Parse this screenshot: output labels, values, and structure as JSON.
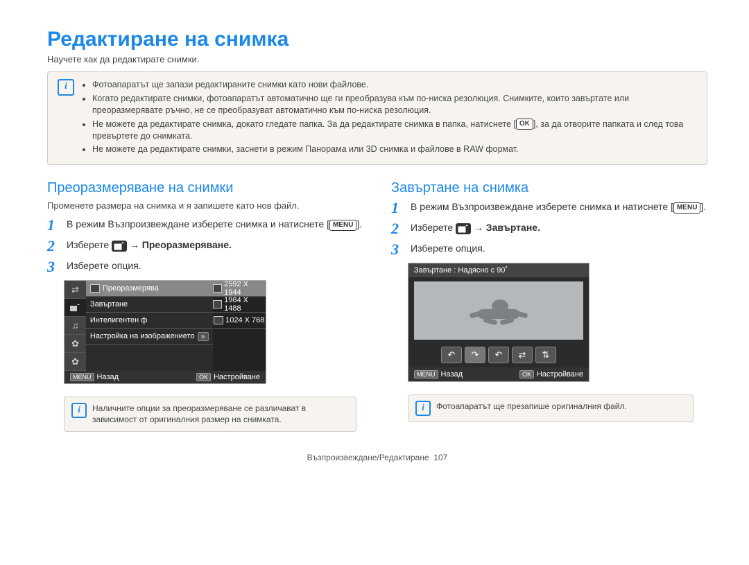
{
  "page": {
    "title": "Редактиране на снимка",
    "intro": "Научете как да редактирате снимки.",
    "footer_section": "Възпроизвеждане/Редактиране",
    "footer_page": "107"
  },
  "top_notes": [
    "Фотоапаратът ще запази редактираните снимки като нови файлове.",
    "Когато редактирате снимки, фотоапаратът автоматично ще ги преобразува към по-ниска резолюция. Снимките, които завъртате или преоразмерявате ръчно, не се преобразуват автоматично към по-ниска резолюция.",
    "Не можете да редактирате снимка, докато гледате папка. За да редактирате снимка в папка, натиснете [OK], за да отворите папката и след това превъртете до снимката.",
    "Не можете да редактирате снимки, заснети в режим Панорама или 3D снимка и файлове в RAW формат."
  ],
  "ok_label": "OK",
  "menu_label": "MENU",
  "left": {
    "heading": "Преоразмеряване на снимки",
    "desc": "Променете размера на снимка и я запишете като нов файл.",
    "steps": {
      "s1": "В режим Възпроизвеждане изберете снимка и натиснете [MENU].",
      "s2_prefix": "Изберете ",
      "s2_suffix": " → Преоразмеряване.",
      "s3": "Изберете опция."
    },
    "shot": {
      "rows": [
        "Преоразмерява",
        "Завъртане",
        "Интелигентен ф",
        "Настройка на изображението"
      ],
      "sizes": [
        "2592 X 1944",
        "1984 X 1488",
        "1024 X 768"
      ],
      "back": "Назад",
      "set": "Настройване",
      "menu_btn": "MENU",
      "ok_btn": "OK"
    },
    "note": "Наличните опции за преоразмеряване се различават в зависимост от оригиналния размер на снимката."
  },
  "right": {
    "heading": "Завъртане на снимка",
    "steps": {
      "s1": "В режим Възпроизвеждане изберете снимка и натиснете [MENU].",
      "s2_prefix": "Изберете ",
      "s2_suffix": " → Завъртане.",
      "s3": "Изберете опция."
    },
    "shot": {
      "title": "Завъртане : Надясно с 90˚",
      "back": "Назад",
      "set": "Настройване",
      "menu_btn": "MENU",
      "ok_btn": "OK"
    },
    "note": "Фотоапаратът ще презапише оригиналния файл."
  }
}
